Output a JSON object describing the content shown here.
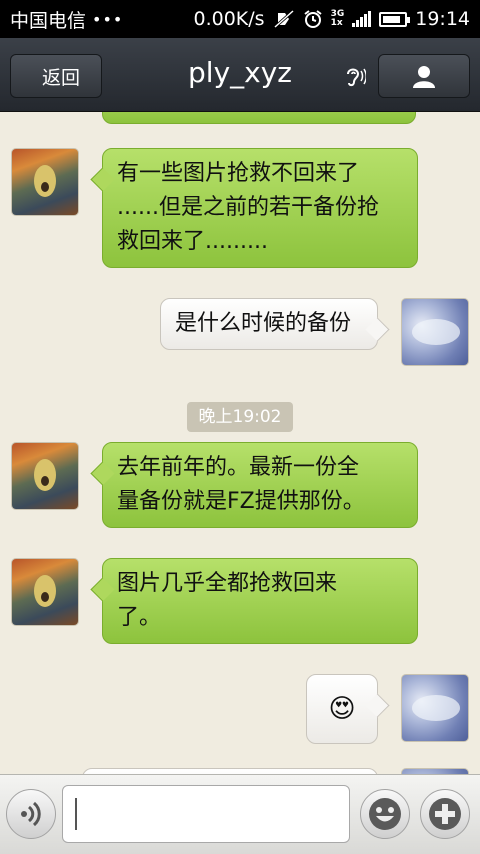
{
  "status_bar": {
    "carrier": "中国电信",
    "dots": "•••",
    "speed": "0.00K/s",
    "network": "3G",
    "network_sub": "1x",
    "time": "19:14",
    "battery_level": 0.85
  },
  "header": {
    "back_label": "返回",
    "title": "ply_xyz",
    "ear_icon": "ear-icon",
    "profile_icon": "person-icon"
  },
  "messages": [
    {
      "side": "left",
      "text_lines": [
        "有一些图片抢救不回来了",
        "......但是之前的若干备份抢",
        "救回来了........."
      ]
    },
    {
      "side": "right",
      "text_lines": [
        "是什么时候的备份"
      ]
    },
    {
      "side": "left",
      "text_lines": [
        "去年前年的。最新一份全",
        "量备份就是FZ提供那份。"
      ]
    },
    {
      "side": "left",
      "text_lines": [
        "图片几乎全都抢救回来",
        "了。"
      ]
    },
    {
      "side": "right",
      "emoji": "😍"
    }
  ],
  "timestamp": "晚上19:02",
  "input": {
    "value": "",
    "voice_icon": "voice-icon",
    "emoji_icon": "smiley-icon",
    "plus_icon": "plus-icon"
  },
  "colors": {
    "bubble_green": "#a3d150",
    "background": "#f0ece0",
    "header": "#2d3137"
  }
}
